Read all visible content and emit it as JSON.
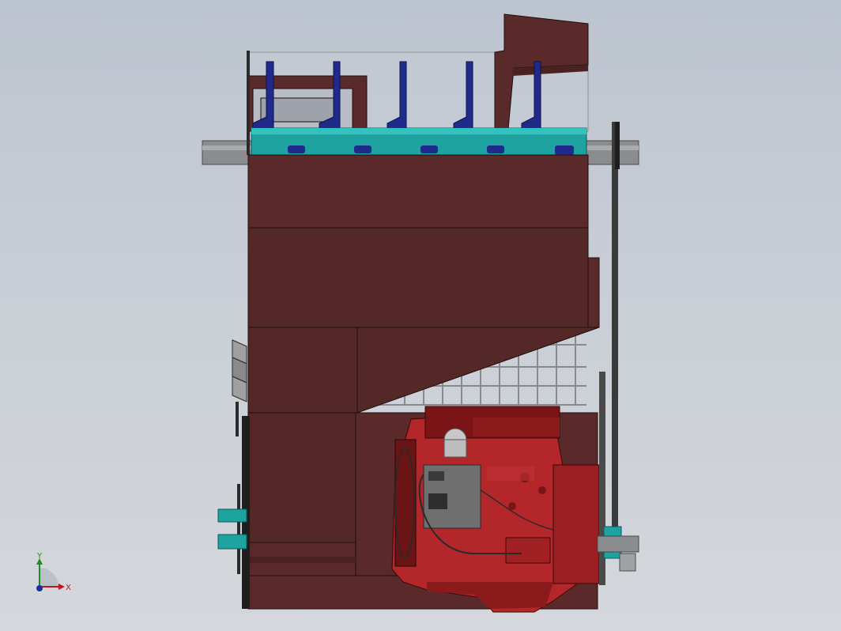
{
  "viewport": {
    "background_top": "#bcc4cf",
    "background_bottom": "#d4d7db"
  },
  "model": {
    "colors": {
      "frame_maroon": "#5a2a2a",
      "frame_dark": "#4a2222",
      "frame_edge": "#1e0e0e",
      "engine_red": "#b3262a",
      "engine_dark": "#7a1416",
      "teal": "#1fa3a0",
      "blue_bracket": "#1f2a8a",
      "shaft_grey": "#8a8c8e",
      "radiator_grey": "#888888",
      "ecu_grey": "#6f6f6f",
      "glass": "#c7ccd6"
    }
  },
  "triad": {
    "x_label": "X",
    "y_label": "Y",
    "x_color": "#c0161c",
    "y_color": "#1a8f1a",
    "z_color": "#1b2f9e"
  }
}
